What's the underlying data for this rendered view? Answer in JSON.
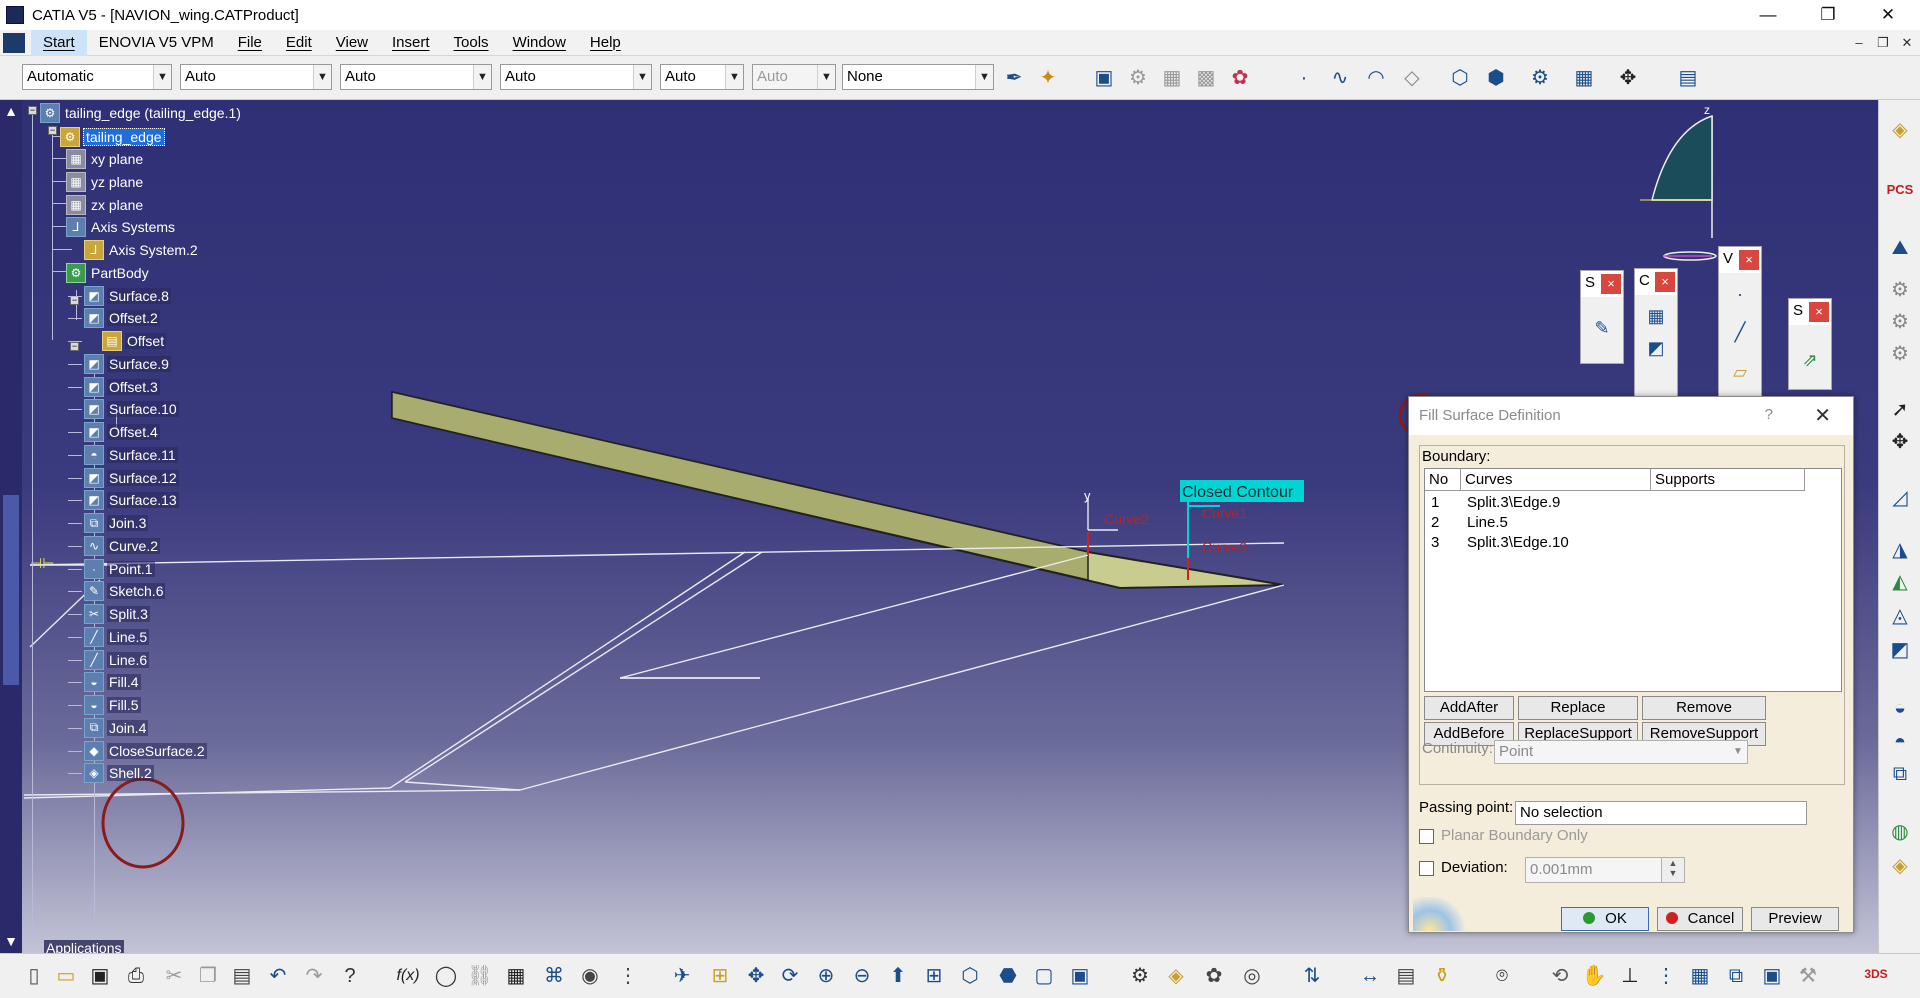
{
  "window": {
    "title": "CATIA V5 - [NAVION_wing.CATProduct]",
    "minimize": "—",
    "restore": "❐",
    "close": "✕"
  },
  "menu": {
    "items": [
      "Start",
      "ENOVIA V5 VPM",
      "File",
      "Edit",
      "View",
      "Insert",
      "Tools",
      "Window",
      "Help"
    ],
    "mdi_min": "‒",
    "mdi_restore": "❐",
    "mdi_close": "✕"
  },
  "toolbar": {
    "combos": [
      {
        "value": "Automatic",
        "disabled": false
      },
      {
        "value": "Auto",
        "disabled": false
      },
      {
        "value": "Auto",
        "disabled": false
      },
      {
        "value": "Auto",
        "disabled": false
      },
      {
        "value": "Auto",
        "disabled": false
      },
      {
        "value": "Auto",
        "disabled": true
      },
      {
        "value": "None",
        "disabled": false
      }
    ],
    "combo_arrow": "▼"
  },
  "tree": {
    "root_label": "tailing_edge (tailing_edge.1)",
    "part_label": "tailing_edge",
    "items": [
      {
        "label": "xy plane",
        "icon": "plane-icon",
        "glyph": "▦"
      },
      {
        "label": "yz plane",
        "icon": "plane-icon",
        "glyph": "▦"
      },
      {
        "label": "zx plane",
        "icon": "plane-icon",
        "glyph": "▦"
      },
      {
        "label": "Axis Systems",
        "icon": "axis-systems-icon",
        "glyph": "⅃"
      },
      {
        "label": "Axis System.2",
        "icon": "axis-system-icon",
        "glyph": "⅃"
      },
      {
        "label": "PartBody",
        "icon": "partbody-icon",
        "glyph": "⚙"
      },
      {
        "label": "Surface.8",
        "icon": "surface-icon",
        "glyph": "◩"
      },
      {
        "label": "Offset.2",
        "icon": "offset-icon",
        "glyph": "◩"
      },
      {
        "label": "Offset",
        "icon": "offset-feature-icon",
        "glyph": "▤"
      },
      {
        "label": "Surface.9",
        "icon": "surface-icon",
        "glyph": "◩"
      },
      {
        "label": "Offset.3",
        "icon": "offset-icon",
        "glyph": "◩"
      },
      {
        "label": "Surface.10",
        "icon": "surface-icon",
        "glyph": "◩"
      },
      {
        "label": "Offset.4",
        "icon": "offset-icon",
        "glyph": "◩"
      },
      {
        "label": "Surface.11",
        "icon": "surface-icon",
        "glyph": "◓"
      },
      {
        "label": "Surface.12",
        "icon": "surface-icon",
        "glyph": "◩"
      },
      {
        "label": "Surface.13",
        "icon": "surface-icon",
        "glyph": "◩"
      },
      {
        "label": "Join.3",
        "icon": "join-icon",
        "glyph": "⧉"
      },
      {
        "label": "Curve.2",
        "icon": "curve-icon",
        "glyph": "∿"
      },
      {
        "label": "Point.1",
        "icon": "point-icon",
        "glyph": "·"
      },
      {
        "label": "Sketch.6",
        "icon": "sketch-icon",
        "glyph": "✎"
      },
      {
        "label": "Split.3",
        "icon": "split-icon",
        "glyph": "✂"
      },
      {
        "label": "Line.5",
        "icon": "line-icon",
        "glyph": "╱"
      },
      {
        "label": "Line.6",
        "icon": "line-icon",
        "glyph": "╱"
      },
      {
        "label": "Fill.4",
        "icon": "fill-icon",
        "glyph": "◒"
      },
      {
        "label": "Fill.5",
        "icon": "fill-icon",
        "glyph": "◒"
      },
      {
        "label": "Join.4",
        "icon": "join-icon",
        "glyph": "⧉"
      },
      {
        "label": "CloseSurface.2",
        "icon": "close-surface-icon",
        "glyph": "◆"
      },
      {
        "label": "Shell.2",
        "icon": "shell-icon",
        "glyph": "◈"
      }
    ],
    "applications_label": "Applications",
    "scroll_up": "▲",
    "scroll_down": "▼"
  },
  "viewport": {
    "closed_contour_label": "Closed Contour",
    "curve_labels": [
      "Curve2",
      "Curve1",
      "Curve3"
    ],
    "compass_z": "z",
    "axis_y": "y"
  },
  "mini_toolbars": [
    {
      "letter": "S",
      "close": "×"
    },
    {
      "letter": "C",
      "close": "×"
    },
    {
      "letter": "V",
      "close": "×"
    },
    {
      "letter": "S",
      "close": "×"
    }
  ],
  "dialog": {
    "title": "Fill Surface Definition",
    "help": "?",
    "close": "✕",
    "boundary_label": "Boundary:",
    "columns": [
      "No",
      "Curves",
      "Supports"
    ],
    "rows": [
      {
        "no": "1",
        "curve": "Split.3\\Edge.9",
        "support": ""
      },
      {
        "no": "2",
        "curve": "Line.5",
        "support": ""
      },
      {
        "no": "3",
        "curve": "Split.3\\Edge.10",
        "support": ""
      }
    ],
    "buttons_row1": [
      "AddAfter",
      "Replace",
      "Remove"
    ],
    "buttons_row2": [
      "AddBefore",
      "ReplaceSupport",
      "RemoveSupport"
    ],
    "continuity_label": "Continuity:",
    "continuity_value": "Point",
    "passing_point_label": "Passing point:",
    "passing_point_value": "No selection",
    "planar_boundary_label": "Planar Boundary Only",
    "deviation_label": "Deviation:",
    "deviation_value": "0.001mm",
    "ok_label": "OK",
    "cancel_label": "Cancel",
    "preview_label": "Preview"
  },
  "colors": {
    "viewport_top": "#2f2f75",
    "viewport_bottom": "#c3c3d6",
    "surface_fill": "#c8cc8e",
    "tree_selection": "#1e6fd9",
    "contour_label_bg": "#00d4d4",
    "curve_label": "#c02020",
    "annotation_circle": "#8b1a1a",
    "dialog_bg": "#f4eddc"
  }
}
